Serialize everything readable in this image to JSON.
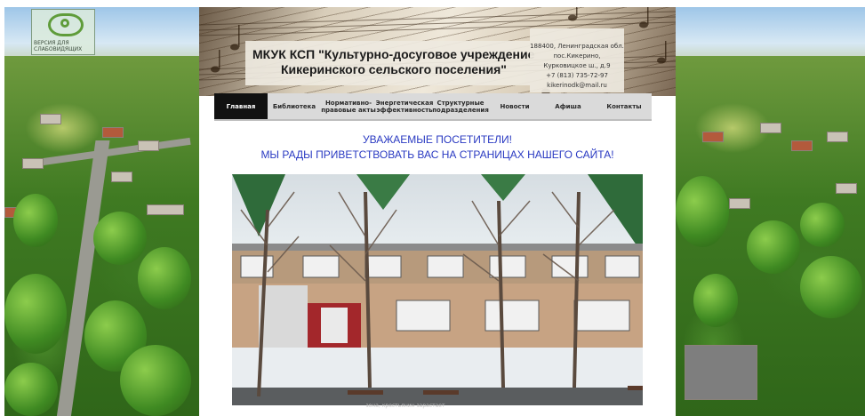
{
  "low_vision": {
    "label": "ВЕРСИЯ ДЛЯ СЛАБОВИДЯЩИХ"
  },
  "header": {
    "title_line1": "МКУК КСП \"Культурно-досуговое учреждение",
    "title_line2": "Кикеринского сельского поселения\"",
    "contact": {
      "address1": "188400, Ленинградская обл.",
      "address2": "пос.Кикерино,",
      "address3": "Курковицкое ш., д.9",
      "phone": "+7 (813) 735-72-97",
      "email": "kikerinodk@mail.ru"
    }
  },
  "nav": {
    "items": [
      {
        "label": "Главная",
        "active": true
      },
      {
        "label": "Библиотека"
      },
      {
        "label": "Нормативно-правовые акты"
      },
      {
        "label": "Энергетическая эффективность"
      },
      {
        "label": "Структурные подразделения"
      },
      {
        "label": "Новости"
      },
      {
        "label": "Афиша"
      },
      {
        "label": "Контакты"
      }
    ]
  },
  "greeting": {
    "line1": "УВАЖАЕМЫЕ ПОСЕТИТЕЛИ!",
    "line2": "МЫ РАДЫ ПРИВЕТСТВОВАТЬ ВАС НА СТРАНИЦАХ НАШЕГО САЙТА!"
  },
  "photo": {
    "caption": "зона, крестьянин зарастает"
  },
  "colors": {
    "accent_text": "#2a3ac2",
    "nav_active": "#111111",
    "nav_bg": "#dadada"
  }
}
